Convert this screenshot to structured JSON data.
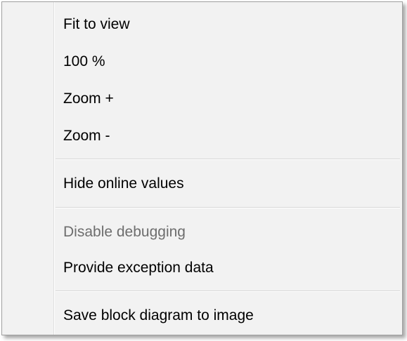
{
  "context_menu": {
    "group_view": {
      "fit_to_view": "Fit to view",
      "zoom_100": "100 %",
      "zoom_in": "Zoom +",
      "zoom_out": "Zoom -"
    },
    "group_online": {
      "hide_online_values": "Hide online values"
    },
    "group_debug": {
      "disable_debugging": "Disable debugging",
      "provide_exception_data": "Provide exception data"
    },
    "group_export": {
      "save_block_diagram": "Save block diagram to image"
    },
    "disabled_items": [
      "Disable debugging"
    ]
  }
}
